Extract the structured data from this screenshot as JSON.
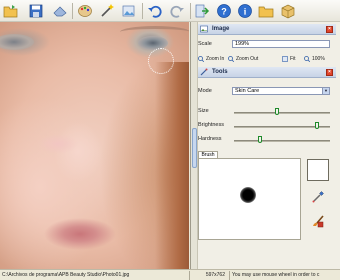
{
  "toolbar": {
    "buttons": [
      {
        "name": "open-folder-icon"
      },
      {
        "name": "save-icon"
      },
      {
        "name": "eraser-icon"
      },
      {
        "name": "palette-icon"
      },
      {
        "name": "magic-wand-icon"
      },
      {
        "name": "photo-export-icon"
      },
      {
        "name": "undo-icon"
      },
      {
        "name": "redo-icon"
      },
      {
        "name": "exit-icon"
      },
      {
        "name": "help-icon"
      },
      {
        "name": "info-icon"
      },
      {
        "name": "folder-icon"
      },
      {
        "name": "package-icon"
      }
    ]
  },
  "image_section": {
    "title": "Image",
    "scale_label": "Scale",
    "scale_value": "199%",
    "zoom_in": "Zoom In",
    "zoom_out": "Zoom Out",
    "fit": "Fit",
    "hundred": "100%"
  },
  "tools_section": {
    "title": "Tools",
    "mode_label": "Mode",
    "mode_value": "Skin Care",
    "sliders": [
      {
        "label": "Size",
        "fraction": 0.45
      },
      {
        "label": "Brightness",
        "fraction": 0.88
      },
      {
        "label": "Hardness",
        "fraction": 0.26
      }
    ],
    "brush_tab": "Brush",
    "brush_color": "#ffffff"
  },
  "statusbar": {
    "path": "C:\\Archivos de programa\\APB Beauty Studio\\Photo01.jpg",
    "dimensions": "597x762",
    "hint": "You may use mouse wheel in order to c"
  },
  "colors": {
    "accent": "#c7d3e6",
    "close": "#e0442a",
    "slider_thumb_border": "#1f8a2a"
  }
}
